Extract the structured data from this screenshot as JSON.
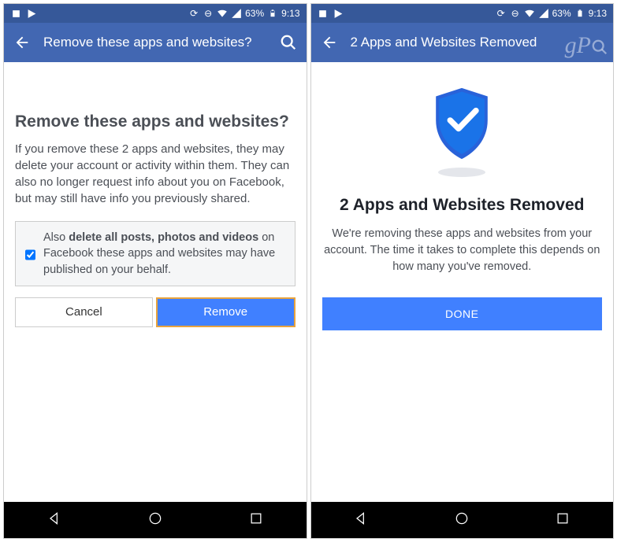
{
  "status": {
    "battery_pct": "63%",
    "time": "9:13"
  },
  "screen1": {
    "appbar_title": "Remove these apps and websites?",
    "heading": "Remove these apps and websites?",
    "body": "If you remove these 2 apps and websites, they may delete your account or activity within them. They can also no longer request info about you on Facebook, but may still have info you previously shared.",
    "checkbox_prefix": "Also ",
    "checkbox_bold": "delete all posts, photos and videos",
    "checkbox_suffix": " on Facebook these apps and websites may have published on your behalf.",
    "cancel": "Cancel",
    "remove": "Remove",
    "checked": true
  },
  "screen2": {
    "appbar_title": "2 Apps and Websites Removed",
    "heading": "2 Apps and Websites Removed",
    "body": "We're removing these apps and websites from your account. The time it takes to complete this depends on how many you've removed.",
    "done": "DONE"
  },
  "watermark": "gP"
}
